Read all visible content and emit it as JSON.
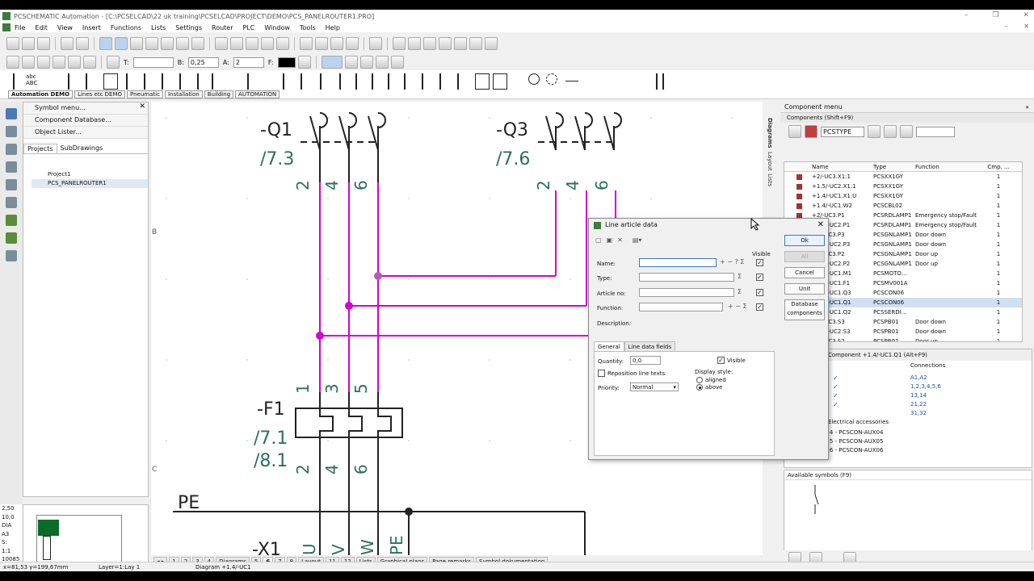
{
  "app": {
    "title": "PCSCHEMATIC Automation - [C:\\PCSELCAD\\22 uk training\\PCSELCAD\\PROJECT\\DEMO\\PCS_PANELROUTER1.PRO]",
    "window_controls": [
      "–",
      "❐",
      "✕"
    ]
  },
  "menu": [
    "File",
    "Edit",
    "View",
    "Insert",
    "Functions",
    "Lists",
    "Settings",
    "Router",
    "PLC",
    "Window",
    "Tools",
    "Help"
  ],
  "toolbar2": {
    "t_label": "T:",
    "b_label": "B:",
    "b_value": "0,25",
    "a_label": "A:",
    "a_value": "2",
    "f_label": "F:"
  },
  "symbol_tabs": [
    "Automation DEMO",
    "Lines etc DEMO",
    "Pneumatic",
    "Installation",
    "Building",
    "AUTOMATION"
  ],
  "symbol_abc": "abc ABC",
  "left_panel": {
    "items": [
      "Symbol menu...",
      "Component Database...",
      "Object Lister..."
    ],
    "tabs": [
      "Projects",
      "SubDrawings"
    ],
    "tree": [
      "Project1",
      "PCS_PANELROUTER1"
    ]
  },
  "coords": [
    "2,50",
    "10,0",
    "DIA",
    "A3",
    "S:",
    "1:1",
    "10085"
  ],
  "canvas": {
    "labels": {
      "q1": "-Q1",
      "q1ref": "/7.3",
      "q3": "-Q3",
      "q3ref": "/7.6",
      "f1": "-F1",
      "f1ref1": "/7.1",
      "f1ref2": "/8.1",
      "pe": "PE",
      "x1": "-X1",
      "n2": "2",
      "n4": "4",
      "n6": "6",
      "n1": "1",
      "n3": "3",
      "n5": "5",
      "u": "U",
      "v": "V",
      "w": "W",
      "pe2": "PE",
      "rowB": "B",
      "rowC": "C"
    }
  },
  "page_tabs": [
    "1",
    "2",
    "3",
    "4",
    "Diagrams",
    "5",
    "6",
    "7",
    "8",
    "Layout",
    "11",
    "12",
    "Lists",
    "Graphical plans",
    "Page remarks",
    "Symbol dokumentation"
  ],
  "status": {
    "coords": "x=81,53 y=199,67mm",
    "layer": "Layer=1:Lay 1",
    "diagram": "Diagram +1.4/-UC1"
  },
  "component_menu": {
    "title": "Component menu",
    "components_label": "Components (Shift+F9)",
    "filter": "PCSTYPE",
    "columns": [
      "Name",
      "Type",
      "Function",
      "Cmp. ..."
    ],
    "rows": [
      {
        "name": "+2/-UC3.X1:1",
        "type": "PCSXX1GY",
        "func": "",
        "cmp": "1"
      },
      {
        "name": "+1.5/-UC2.X1:1",
        "type": "PCSXX1GY",
        "func": "",
        "cmp": "1"
      },
      {
        "name": "+1.4/-UC1.X1:U",
        "type": "PCSXX1GY",
        "func": "",
        "cmp": "1"
      },
      {
        "name": "+1.4/-UC1.W2",
        "type": "PCSCBL02",
        "func": "",
        "cmp": "1"
      },
      {
        "name": "+2/-UC3.P1",
        "type": "PCSRDLAMP1",
        "func": "Emergency stop/Fault",
        "cmp": "1"
      },
      {
        "name": "+1.5/-UC2.P1",
        "type": "PCSRDLAMP1",
        "func": "Emergency stop/Fault",
        "cmp": "1"
      },
      {
        "name": "+2/-UC3.P3",
        "type": "PCSGNLAMP1",
        "func": "Door down",
        "cmp": "1"
      },
      {
        "name": "+1.5/-UC2.P3",
        "type": "PCSGNLAMP1",
        "func": "Door down",
        "cmp": "1"
      },
      {
        "name": "+2/-UC3.P2",
        "type": "PCSGNLAMP1",
        "func": "Door up",
        "cmp": "1"
      },
      {
        "name": "+1.5/-UC2.P2",
        "type": "PCSGNLAMP1",
        "func": "Door up",
        "cmp": "1"
      },
      {
        "name": "+1.4/-UC1.M1",
        "type": "PCSMOTO...",
        "func": "",
        "cmp": "1"
      },
      {
        "name": "+1.4/-UC1.F1",
        "type": "PCSMV001A",
        "func": "",
        "cmp": "1"
      },
      {
        "name": "+1.4/-UC1.Q3",
        "type": "PCSCON06",
        "func": "",
        "cmp": "1"
      },
      {
        "name": "+1.4/-UC1.Q1",
        "type": "PCSCON06",
        "func": "",
        "cmp": "1"
      },
      {
        "name": "+1.4/-UC1.Q2",
        "type": "PCSSERDI...",
        "func": "",
        "cmp": "1"
      },
      {
        "name": "+2/-UC3.S3",
        "type": "PCSPB01",
        "func": "Door down",
        "cmp": "1"
      },
      {
        "name": "+1.5/-UC2.S3",
        "type": "PCSPB01",
        "func": "Door down",
        "cmp": "1"
      },
      {
        "name": "+2/-UC3.S2",
        "type": "PCSPB01",
        "func": "Door up",
        "cmp": "1"
      }
    ],
    "details_title": "Component +1.4/-UC1.Q1 (Alt+F9)",
    "connections_label": "Connections",
    "connections": [
      "A1,A2",
      "1,2,3,4,5,6",
      "13,14",
      "21,22",
      "31,32"
    ],
    "accessories_label": "Electrical accessories",
    "accessories": [
      "PCS220124 - PCSCON-AUX04",
      "PCS220125 - PCSCON-AUX05",
      "PCS220126 - PCSCON-AUX06"
    ],
    "available_label": "Available symbols (F9)",
    "side_tabs": [
      "Diagrams",
      "Layout",
      "Lists"
    ]
  },
  "dialog": {
    "title": "Line article data",
    "visible_label": "Visible",
    "fields": [
      {
        "label": "Name:",
        "value": ""
      },
      {
        "label": "Type:",
        "value": ""
      },
      {
        "label": "Article no:",
        "value": ""
      },
      {
        "label": "Function:",
        "value": ""
      }
    ],
    "description_label": "Description:",
    "buttons": [
      "Ok",
      "All",
      "Cancel",
      "Unit",
      "Database",
      "components"
    ],
    "tabs": [
      "General",
      "Line data fields"
    ],
    "quantity_label": "Quantity:",
    "quantity_value": "0,0",
    "visible_chk_label": "Visible",
    "reposition_label": "Reposition line texts",
    "priority_label": "Priority:",
    "priority_value": "Normal",
    "display_style_label": "Display style:",
    "display_options": [
      "aligned",
      "above"
    ]
  }
}
